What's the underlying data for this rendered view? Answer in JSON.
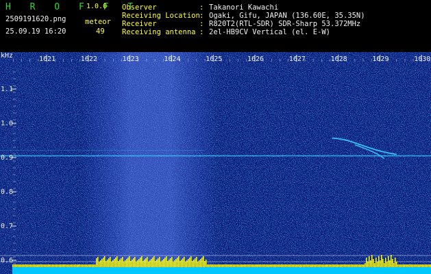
{
  "header": {
    "logo": "H R O F F T",
    "version": "1.0.0",
    "filename": "2509191620.png",
    "datetime": "25.09.19 16:20",
    "meteor_label": "meteor",
    "meteor_count": "49",
    "fields": [
      {
        "label": "Observer",
        "colon": ":",
        "value": "Takanori Kawachi"
      },
      {
        "label": "Receiving Location",
        "colon": ":",
        "value": "Ogaki, Gifu, JAPAN (136.60E, 35.35N)"
      },
      {
        "label": "Receiver",
        "colon": ":",
        "value": "R820T2(RTL-SDR) SDR-Sharp 53.372MHz"
      },
      {
        "label": "Receiving antenna",
        "colon": ":",
        "value": "2el-HB9CV Vertical (el. E-W)"
      }
    ]
  },
  "chart_data": {
    "type": "heatmap",
    "ylabel": "kHz",
    "x_ticks": [
      "1621",
      "1622",
      "1623",
      "1624",
      "1625",
      "1626",
      "1627",
      "1628",
      "1629",
      "1630"
    ],
    "y_ticks": [
      "1.1",
      "1.0",
      "0.9",
      "0.8",
      "0.7",
      "0.6"
    ],
    "ylim": [
      0.58,
      1.2
    ],
    "background_color": "#0a1a7a",
    "signal_color": "#33ccff",
    "carrier_freq": 0.905,
    "bar_color": "#ffff00",
    "bright_band_minutes": [
      1622.5,
      1624.5
    ]
  }
}
